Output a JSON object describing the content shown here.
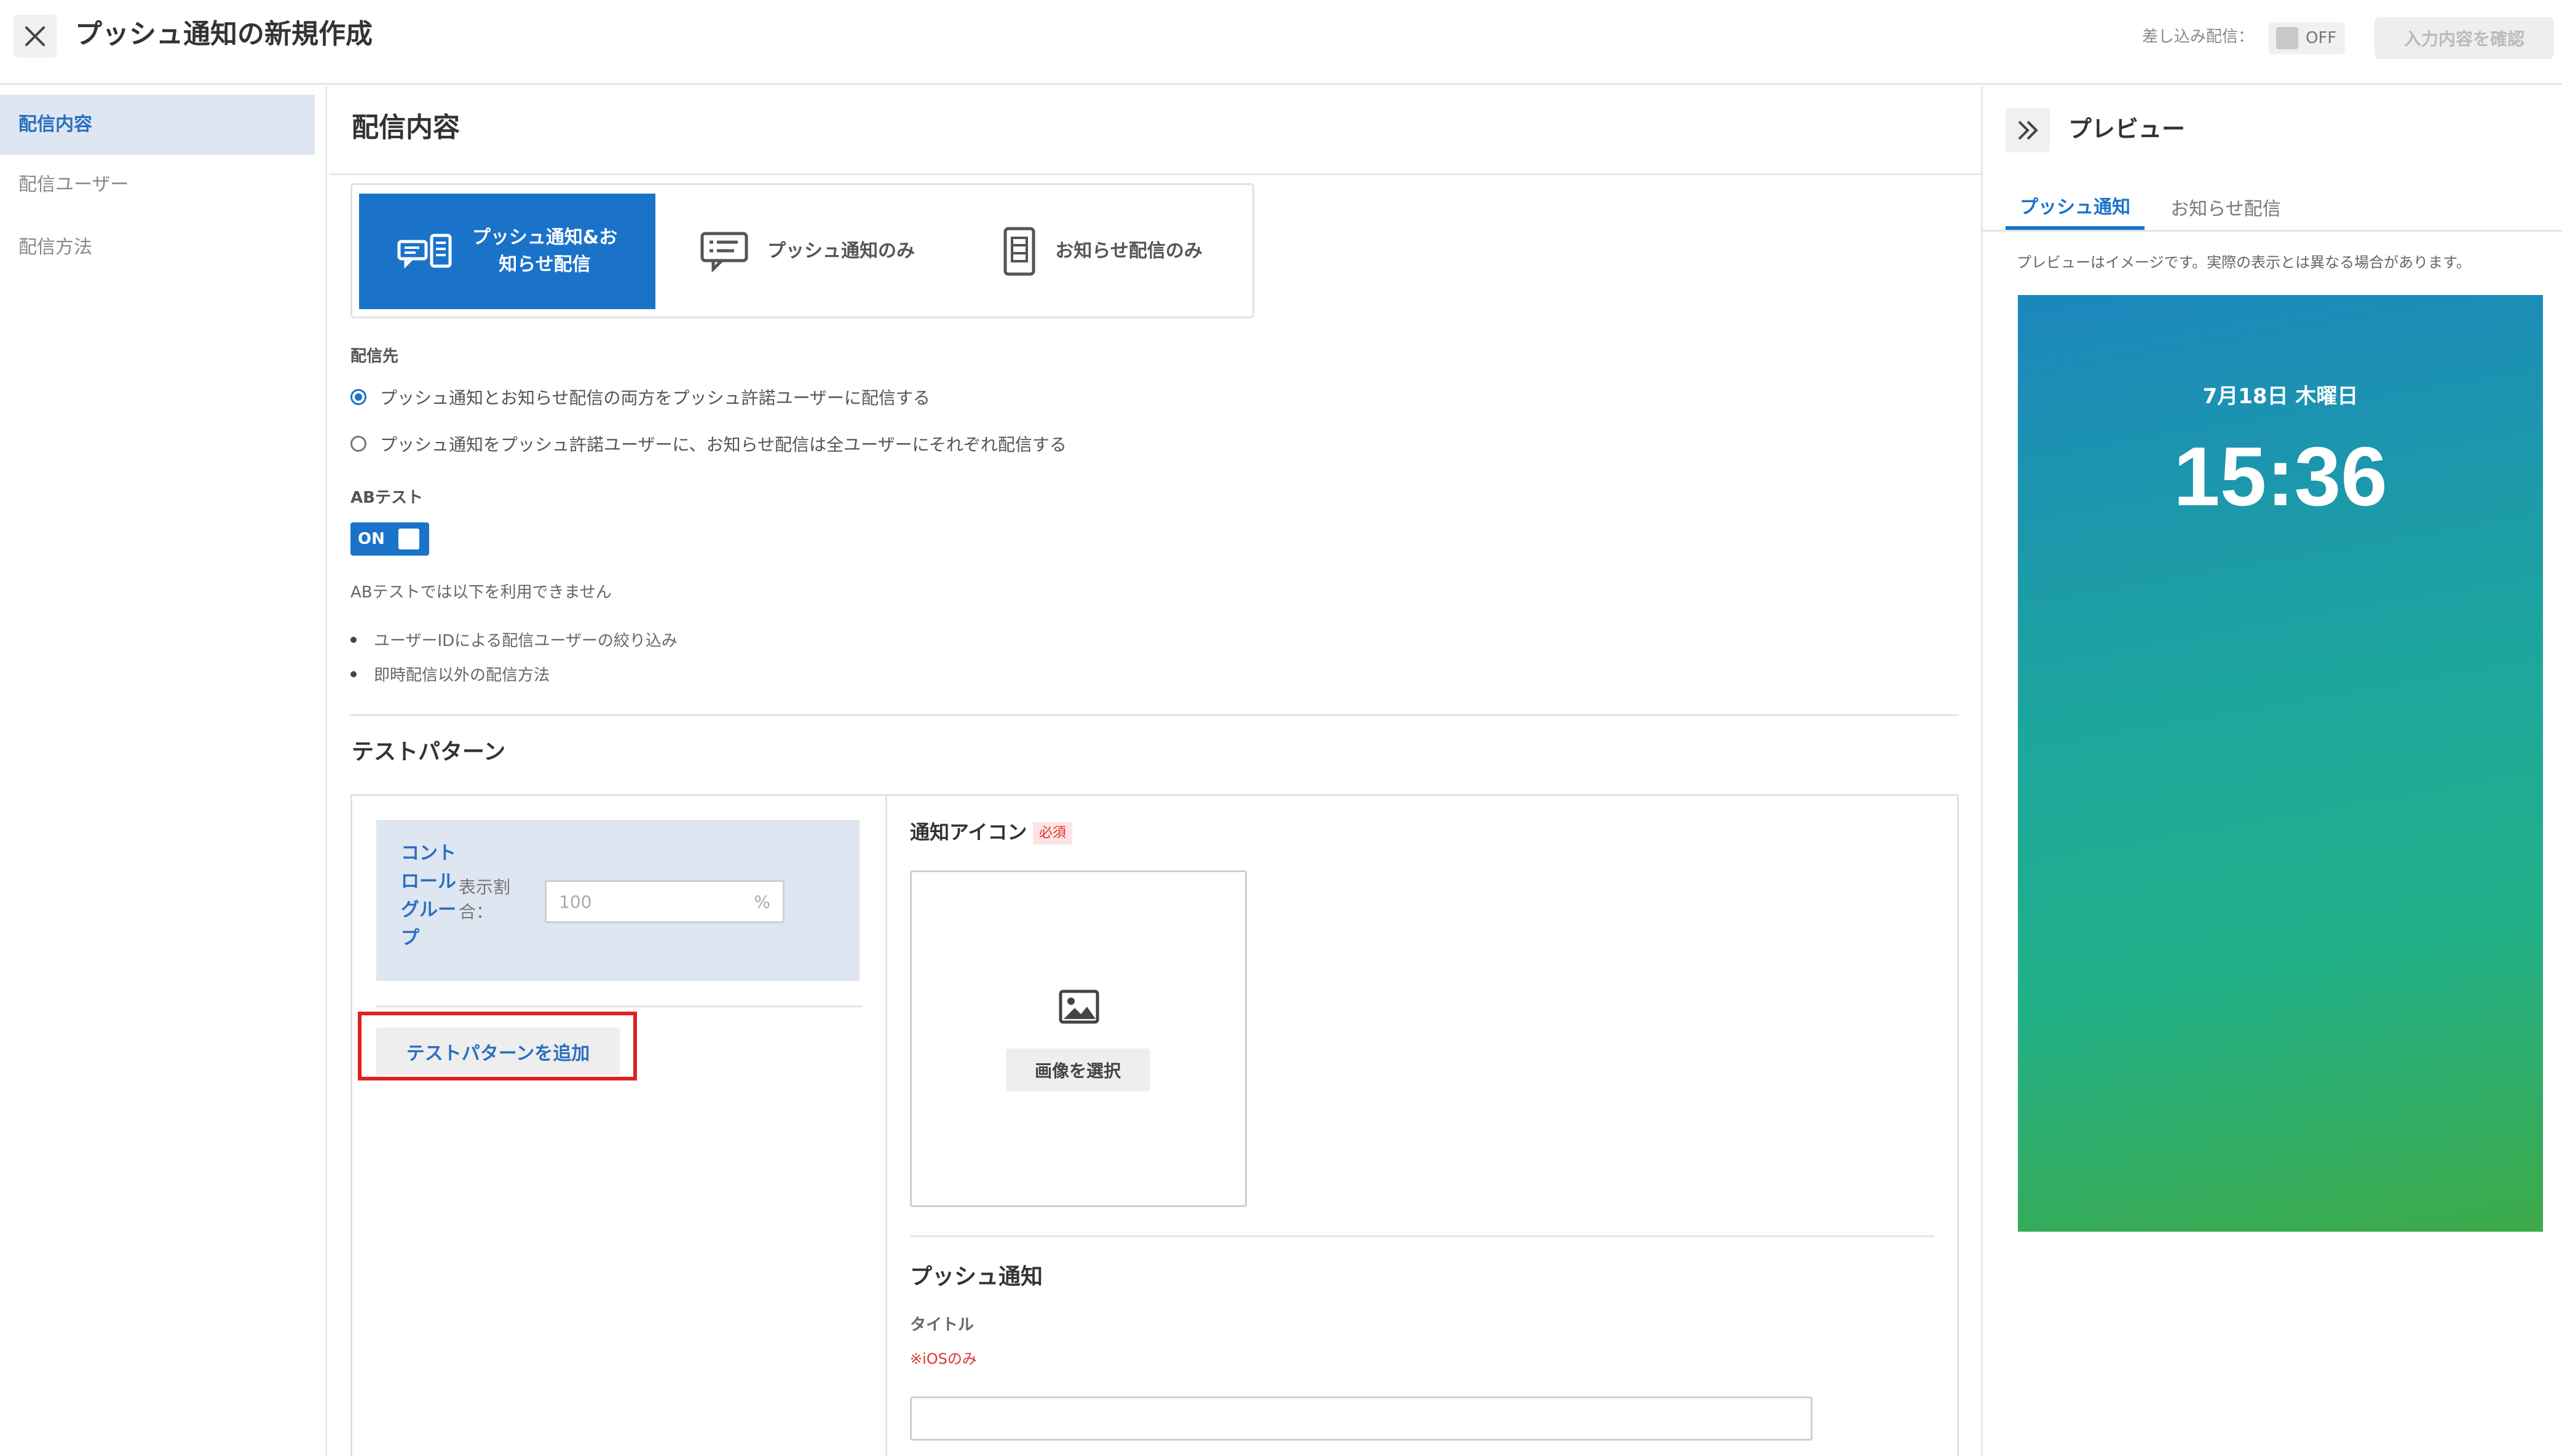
{
  "header": {
    "title": "プッシュ通知の新規作成",
    "merge_delivery_label": "差し込み配信：",
    "merge_delivery_state": "OFF",
    "confirm_button": "入力内容を確認"
  },
  "sidebar": {
    "items": [
      {
        "label": "配信内容",
        "active": true
      },
      {
        "label": "配信ユーザー",
        "active": false
      },
      {
        "label": "配信方法",
        "active": false
      }
    ]
  },
  "main": {
    "title": "配信内容",
    "delivery_types": [
      {
        "label_line1": "プッシュ通知&お",
        "label_line2": "知らせ配信",
        "icon": "push-and-news-icon",
        "selected": true
      },
      {
        "label": "プッシュ通知のみ",
        "icon": "chat-message-icon",
        "selected": false
      },
      {
        "label": "お知らせ配信のみ",
        "icon": "document-icon",
        "selected": false
      }
    ],
    "destination": {
      "label": "配信先",
      "options": [
        {
          "label": "プッシュ通知とお知らせ配信の両方をプッシュ許諾ユーザーに配信する",
          "selected": true
        },
        {
          "label": "プッシュ通知をプッシュ許諾ユーザーに、お知らせ配信は全ユーザーにそれぞれ配信する",
          "selected": false
        }
      ]
    },
    "ab_test": {
      "label": "ABテスト",
      "state": "ON",
      "note": "ABテストでは以下を利用できません",
      "restrictions": [
        "ユーザーIDによる配信ユーザーの絞り込み",
        "即時配信以外の配信方法"
      ]
    },
    "test_pattern": {
      "title": "テストパターン",
      "control_group": {
        "name": "コントロールグループ",
        "ratio_label": "表示割合：",
        "ratio_value": "100",
        "ratio_unit": "%"
      },
      "add_button": "テストパターンを追加"
    },
    "notification_icon": {
      "label": "通知アイコン",
      "required_badge": "必須",
      "select_button": "画像を選択"
    },
    "push_notification": {
      "title": "プッシュ通知",
      "title_field_label": "タイトル",
      "ios_note": "※iOSのみ",
      "title_value": ""
    }
  },
  "preview": {
    "title": "プレビュー",
    "tabs": [
      {
        "label": "プッシュ通知",
        "active": true
      },
      {
        "label": "お知らせ配信",
        "active": false
      }
    ],
    "note": "プレビューはイメージです。実際の表示とは異なる場合があります。",
    "phone_date": "7月18日 木曜日",
    "phone_time": "15:36"
  },
  "colors": {
    "accent": "#1a73c9",
    "highlight_border": "#e02020",
    "required": "#dd3333",
    "nav_active_bg": "#dde6f1"
  }
}
